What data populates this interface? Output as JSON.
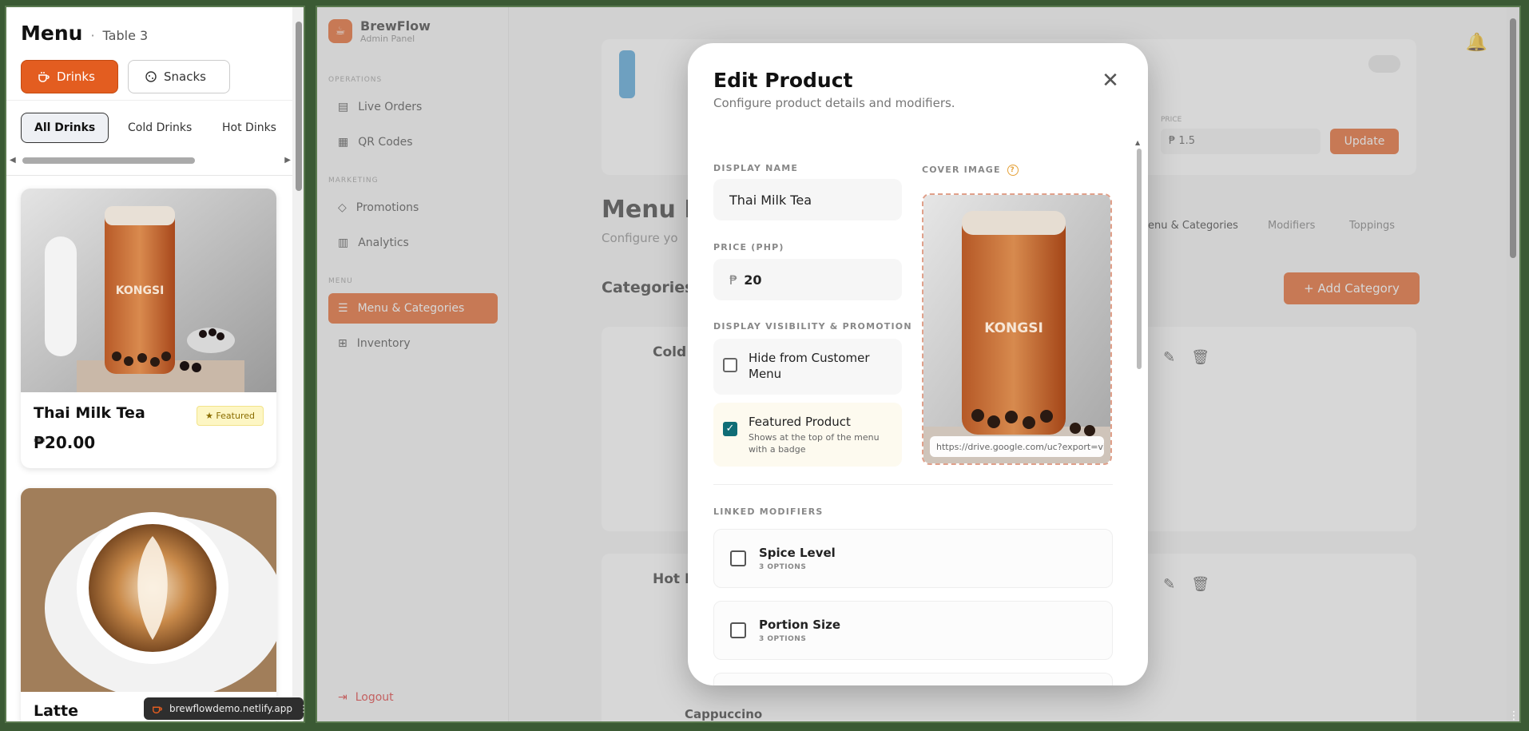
{
  "left_panel": {
    "title": "Menu",
    "table_label": "Table 3",
    "main_tabs": [
      "Drinks",
      "Snacks"
    ],
    "sub_tabs": [
      "All Drinks",
      "Cold Drinks",
      "Hot Dinks"
    ],
    "products": [
      {
        "name": "Thai Milk Tea",
        "price": "₱20.00",
        "badge": "★ Featured"
      },
      {
        "name": "Latte"
      }
    ],
    "url": "brewflowdemo.netlify.app"
  },
  "app": {
    "brand_name": "BrewFlow",
    "brand_sub": "Admin Panel",
    "sections": [
      "OPERATIONS",
      "MARKETING",
      "MENU"
    ],
    "nav_items": [
      "Live Orders",
      "QR Codes",
      "Promotions",
      "Analytics",
      "Menu & Categories",
      "Inventory"
    ],
    "logout": "Logout",
    "page_title": "Menu Ma",
    "page_sub": "Configure yo",
    "categories_heading": "Categories",
    "tabs": [
      "enu & Categories",
      "Modifiers",
      "Toppings"
    ],
    "add_category": "+ Add Category",
    "price_label": "PRICE",
    "price_value": "₱ 1.5",
    "update_btn": "Update",
    "cat_names": [
      "Cold",
      "Hot D"
    ],
    "cappuccino": "Cappuccino"
  },
  "modal": {
    "title": "Edit Product",
    "subtitle": "Configure product details and modifiers.",
    "display_name_label": "DISPLAY NAME",
    "display_name": "Thai Milk Tea",
    "price_label": "PRICE (PHP)",
    "price_symbol": "₱",
    "price": "20",
    "visibility_label": "DISPLAY VISIBILITY & PROMOTION",
    "hide_label": "Hide from Customer Menu",
    "featured_label": "Featured Product",
    "featured_desc": "Shows at the top of the menu with a badge",
    "cover_label": "COVER IMAGE",
    "cover_url": "https://drive.google.com/uc?export=view",
    "modifiers_label": "LINKED MODIFIERS",
    "modifiers": [
      {
        "name": "Spice Level",
        "count": "3 OPTIONS"
      },
      {
        "name": "Portion Size",
        "count": "3 OPTIONS"
      }
    ]
  },
  "colors": {
    "accent": "#e35d20",
    "check": "#0f6d76"
  }
}
